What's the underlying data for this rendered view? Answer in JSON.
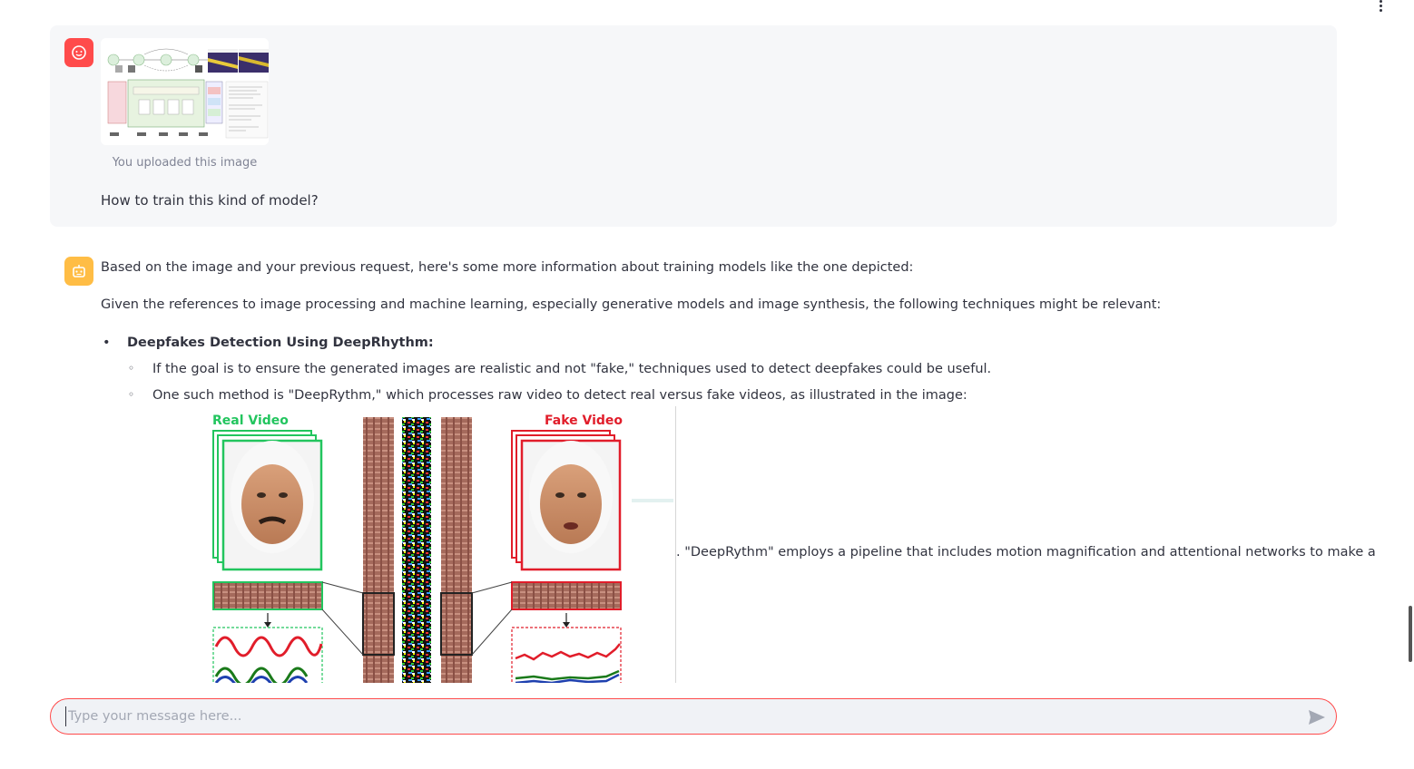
{
  "app": {
    "menu_icon": "vertical-dots-icon"
  },
  "user_message": {
    "avatar_icon": "smile-face-icon",
    "image_caption": "You uploaded this image",
    "text": "How to train this kind of model?"
  },
  "assistant_message": {
    "avatar_icon": "robot-icon",
    "intro": "Based on the image and your previous request, here's some more information about training models like the one depicted:",
    "context": "Given the references to image processing and machine learning, especially generative models and image synthesis, the following techniques might be relevant:",
    "section_title": "Deepfakes Detection Using DeepRhythm:",
    "sub_items": [
      "If the goal is to ensure the generated images are realistic and not \"fake,\" techniques used to detect deepfakes could be useful.",
      "One such method is \"DeepRythm,\" which processes raw video to detect real versus fake videos, as illustrated in the image:"
    ],
    "figure": {
      "real_label": "Real Video",
      "fake_label": "Fake Video"
    },
    "after_figure": ". \"DeepRythm\" employs a pipeline that includes motion magnification and attentional networks to make a"
  },
  "chat_input": {
    "placeholder": "Type your message here...",
    "value": "",
    "send_icon": "send-arrow-icon"
  },
  "colors": {
    "accent": "#ff4b4b",
    "bot": "#ffbd45",
    "real": "#22c55e",
    "fake": "#e11d2a"
  }
}
